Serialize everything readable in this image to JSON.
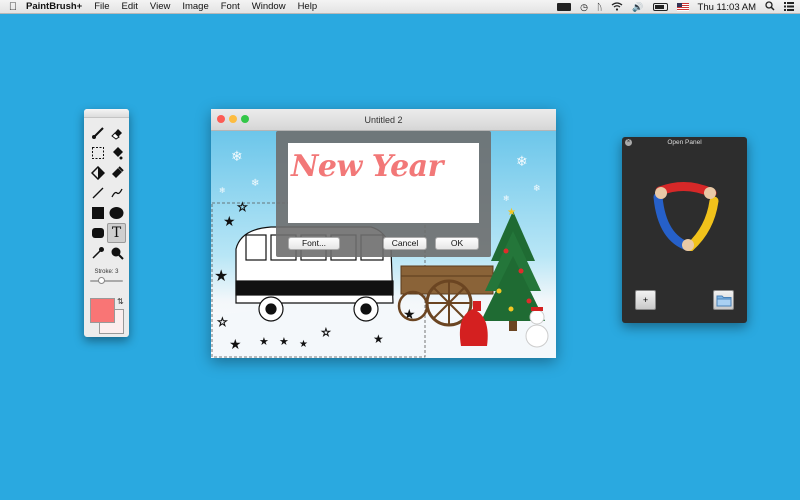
{
  "menubar": {
    "app_name": "PaintBrush+",
    "items": [
      "File",
      "Edit",
      "View",
      "Image",
      "Font",
      "Window",
      "Help"
    ],
    "clock": "Thu 11:03 AM",
    "icons": [
      "apple-icon",
      "battery-app-icon",
      "time-machine-icon",
      "bluetooth-icon",
      "wifi-icon",
      "volume-icon",
      "battery-icon",
      "us-flag-icon",
      "spotlight-icon",
      "notification-center-icon"
    ]
  },
  "tools": {
    "stroke_label": "Stroke: 3",
    "stroke_value": 3,
    "foreground_color": "#f97575",
    "background_color": "#fbeeee",
    "active_tool": "text"
  },
  "document": {
    "title": "Untitled 2"
  },
  "text_dialog": {
    "text": "New Year",
    "font_button": "Font...",
    "cancel_button": "Cancel",
    "ok_button": "OK",
    "text_color": "#f27878"
  },
  "open_panel": {
    "title": "Open Panel",
    "add_button": "+"
  },
  "colors": {
    "desktop": "#2aa9e0"
  }
}
